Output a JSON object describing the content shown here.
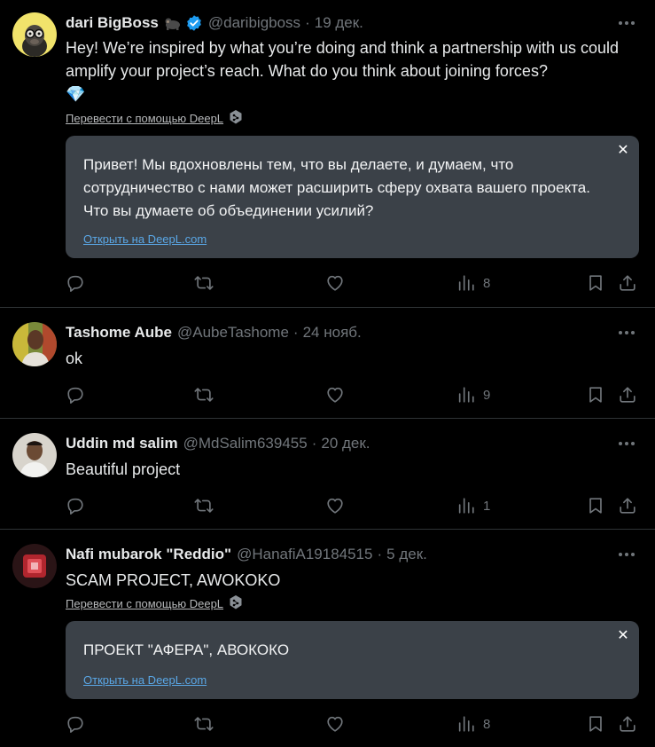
{
  "tweets": [
    {
      "name": "dari BigBoss",
      "badge_emoji": "gorilla",
      "verified": true,
      "handle": "@daribigboss",
      "date": "19 дек.",
      "text": "Hey! We’re inspired by what you’re doing and think a partnership with us could amplify your project’s reach. What do you think about joining forces?",
      "text_emoji": "💎",
      "translate_link": "Перевести с помощью DeepL",
      "translation": "Привет! Мы вдохновлены тем, что вы делаете, и думаем, что сотрудничество с нами может расширить сферу охвата вашего проекта. Что вы думаете об объединении усилий?",
      "open_link": "Открыть на DeepL.com",
      "close": "✕",
      "views": "8"
    },
    {
      "name": "Tashome Aube",
      "handle": "@AubeTashome",
      "date": "24 нояб.",
      "text": "ok",
      "views": "9"
    },
    {
      "name": "Uddin md salim",
      "handle": "@MdSalim639455",
      "date": "20 дек.",
      "text": "Beautiful project",
      "views": "1"
    },
    {
      "name": "Nafi mubarok \"Reddio\"",
      "handle": "@HanafiA19184515",
      "date": "5 дек.",
      "text": "SCAM PROJECT, AWOKOKO",
      "translate_link": "Перевести с помощью DeepL",
      "translation": "ПРОЕКТ \"АФЕРА\", АВОКОКО",
      "open_link": "Открыть на DeepL.com",
      "close": "✕",
      "views": "8"
    }
  ],
  "separator": "·",
  "icons": [
    "reply-icon",
    "retweet-icon",
    "like-icon",
    "views-icon",
    "bookmark-icon",
    "share-icon",
    "more-icon",
    "verified-icon",
    "deepl-icon"
  ],
  "colors": {
    "background": "#000000",
    "text": "#e7e9ea",
    "muted": "#71767b",
    "card": "#3b4148",
    "link": "#5aa7e6",
    "verified": "#1d9bf0"
  }
}
